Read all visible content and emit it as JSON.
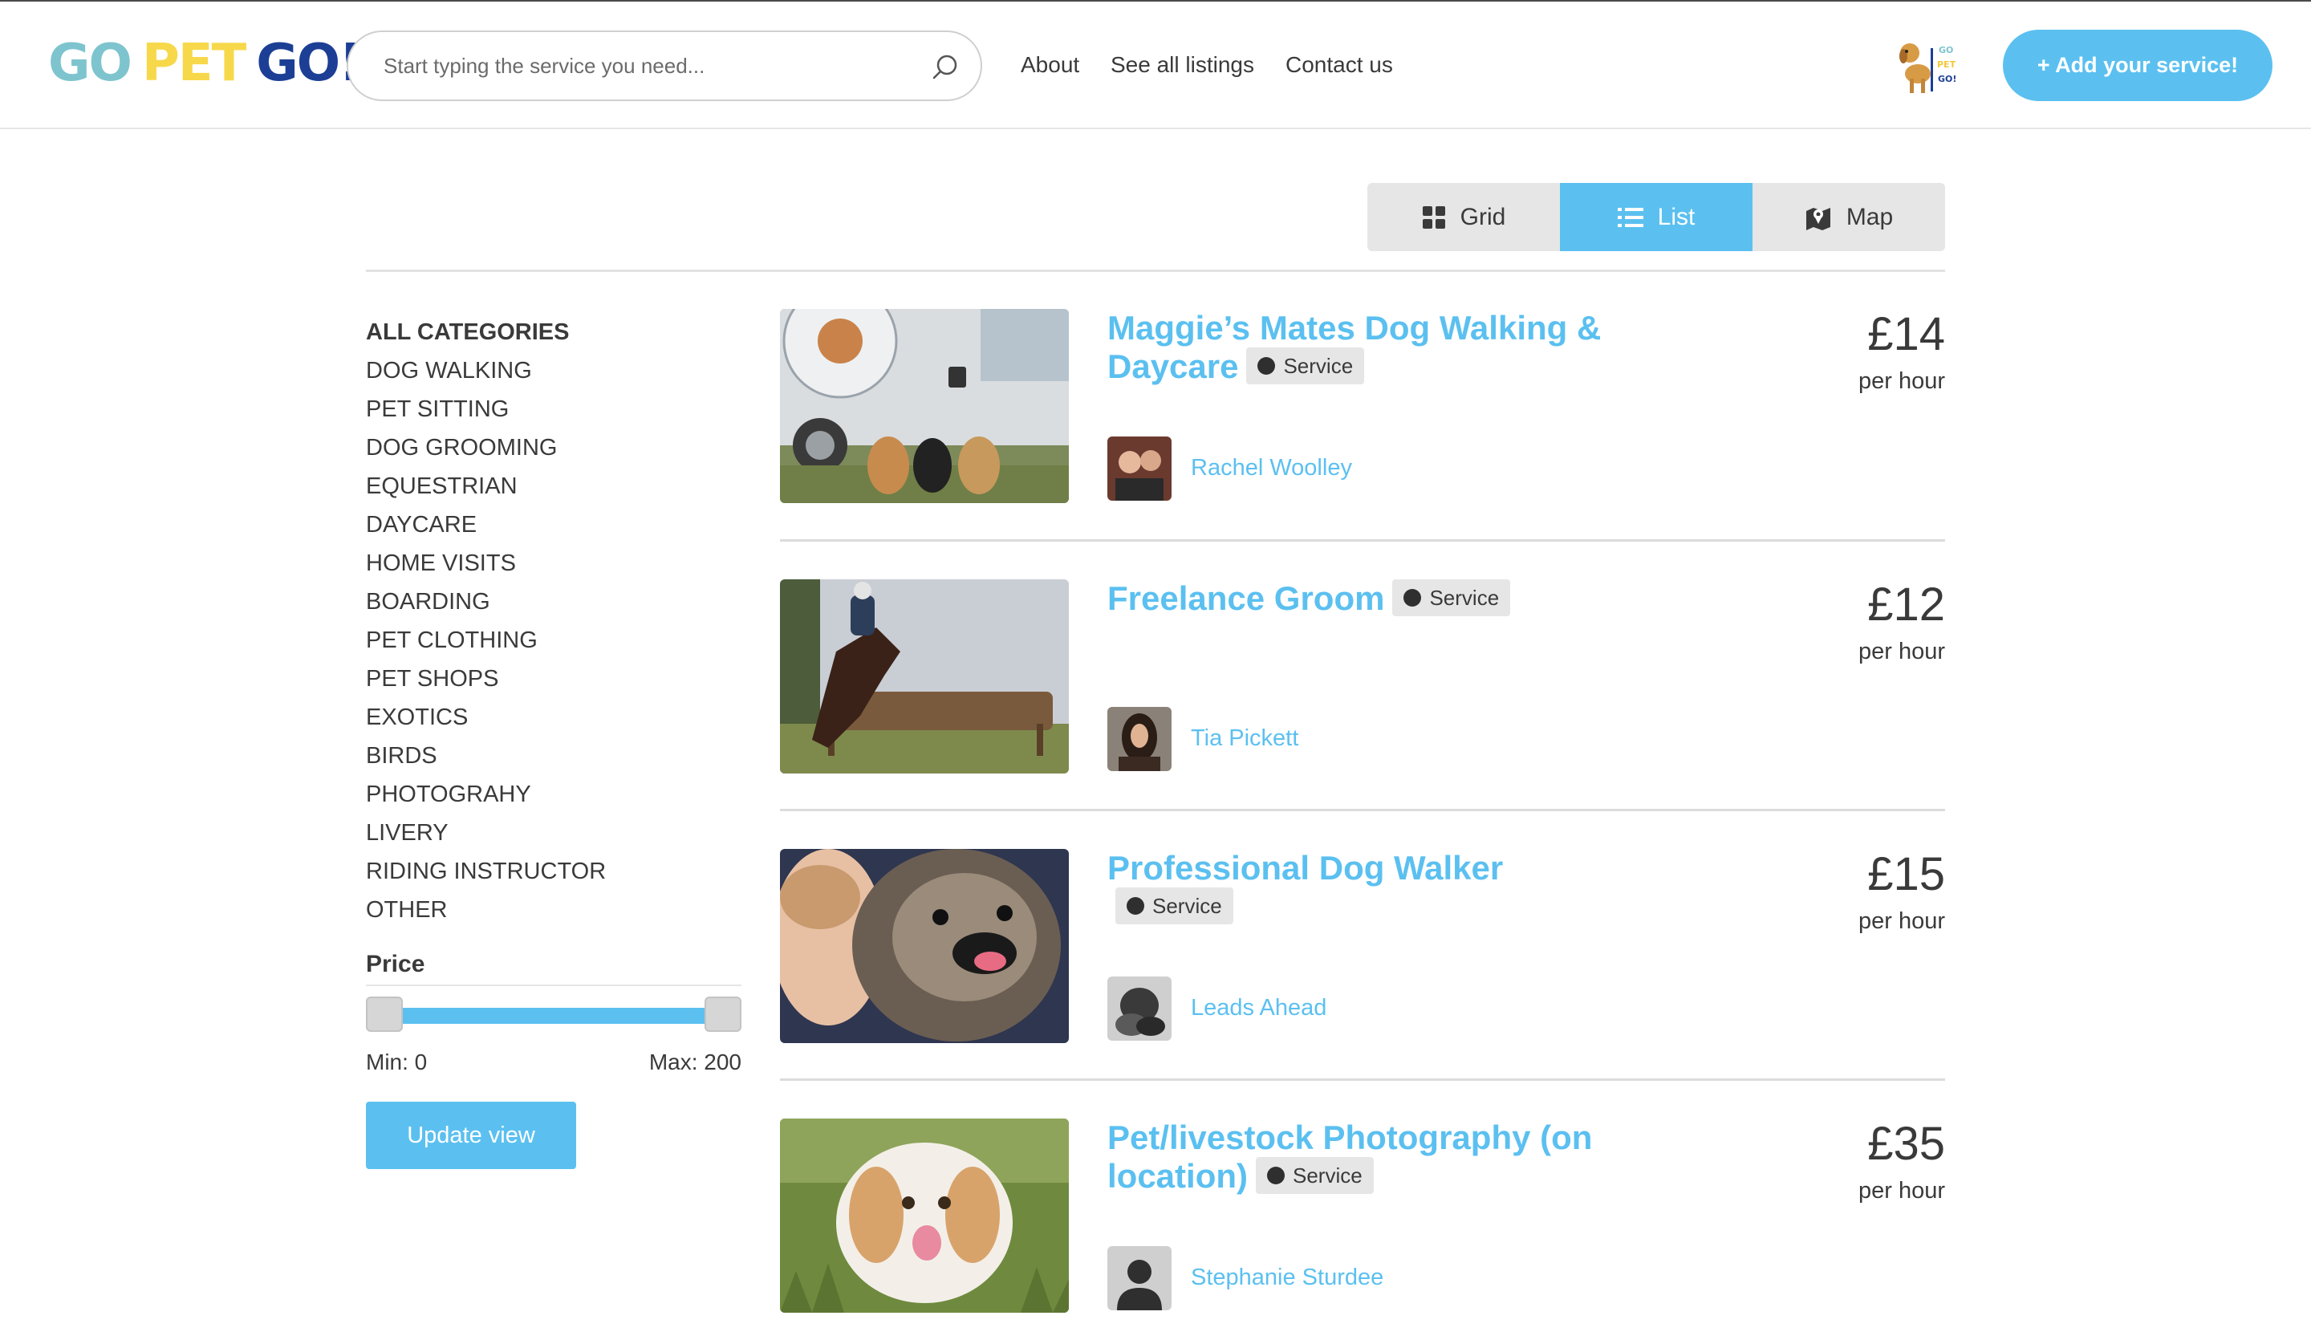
{
  "brand": {
    "word1": "GO",
    "word2": "PET",
    "word3": "GO!"
  },
  "search": {
    "placeholder": "Start typing the service you need..."
  },
  "nav": {
    "about": "About",
    "listings": "See all listings",
    "contact": "Contact us"
  },
  "mascot": {
    "line1": "GO",
    "line2": "PET",
    "line3": "GO!"
  },
  "add_button": "+ Add your service!",
  "view_toggle": {
    "grid": "Grid",
    "list": "List",
    "map": "Map",
    "active": "List"
  },
  "sidebar": {
    "categories": [
      "ALL CATEGORIES",
      "DOG WALKING",
      "PET SITTING",
      "DOG GROOMING",
      "EQUESTRIAN",
      "DAYCARE",
      "HOME VISITS",
      "BOARDING",
      "PET CLOTHING",
      "PET SHOPS",
      "EXOTICS",
      "BIRDS",
      "PHOTOGRAHY",
      "LIVERY",
      "RIDING INSTRUCTOR",
      "OTHER"
    ],
    "price_title": "Price",
    "min_label": "Min: 0",
    "max_label": "Max: 200",
    "update_button": "Update view"
  },
  "listings": [
    {
      "title": "Maggie’s Mates Dog Walking & Daycare",
      "badge": "Service",
      "owner": "Rachel Woolley",
      "price": "£14",
      "unit": "per hour",
      "image": "van-with-dogs"
    },
    {
      "title": "Freelance Groom",
      "badge": "Service",
      "owner": "Tia Pickett",
      "price": "£12",
      "unit": "per hour",
      "image": "horse-jumping"
    },
    {
      "title": "Professional Dog Walker",
      "badge": "Service",
      "owner": "Leads Ahead",
      "price": "£15",
      "unit": "per hour",
      "image": "woman-with-dog"
    },
    {
      "title": "Pet/livestock Photography (on location)",
      "badge": "Service",
      "owner": "Stephanie Sturdee",
      "price": "£35",
      "unit": "per hour",
      "image": "spaniel-in-grass"
    }
  ],
  "colors": {
    "accent": "#5bc0f0",
    "text": "#3a3a3a",
    "logo_teal": "#7ec4cf",
    "logo_yellow": "#f7d84a",
    "logo_navy": "#1c3f95"
  }
}
